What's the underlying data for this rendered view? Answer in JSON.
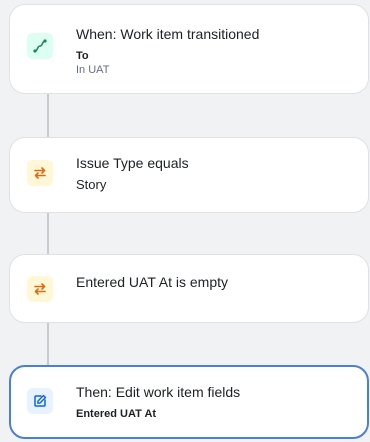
{
  "flow": {
    "trigger": {
      "title": "When: Work item transitioned",
      "field_label": "To",
      "field_value": "In UAT",
      "icon": "transition-arrow-icon",
      "icon_bg": "#dcfff1",
      "icon_color": "#1f845a"
    },
    "condition_1": {
      "title": "Issue Type equals",
      "value": "Story",
      "icon": "swap-arrows-icon",
      "icon_bg": "#fff7d6",
      "icon_color": "#e56910"
    },
    "condition_2": {
      "title": "Entered UAT At is empty",
      "icon": "swap-arrows-icon",
      "icon_bg": "#fff7d6",
      "icon_color": "#e56910"
    },
    "action": {
      "title": "Then: Edit work item fields",
      "field": "Entered UAT At",
      "icon": "edit-pencil-icon",
      "icon_bg": "#e9f2ff",
      "icon_color": "#0c66e4"
    }
  },
  "colors": {
    "selected_border": "#4a7fd6",
    "connector": "#c7cbd1",
    "background": "#f1f2f4"
  }
}
